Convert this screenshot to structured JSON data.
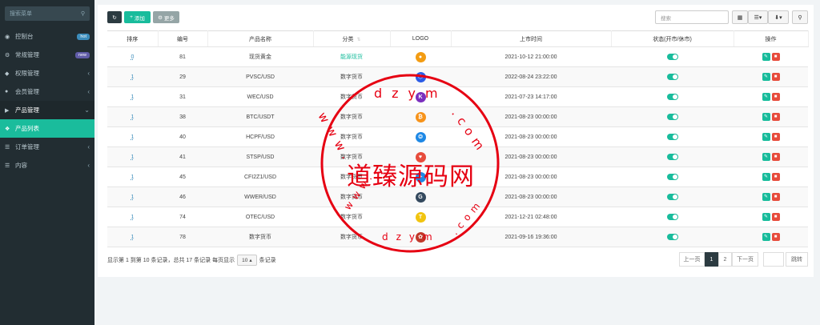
{
  "sidebar": {
    "search_placeholder": "搜索菜单",
    "items": [
      {
        "label": "控制台",
        "badge": "hot",
        "badge_color": "#3c8dbc"
      },
      {
        "label": "常规管理",
        "badge": "new",
        "badge_color": "#605ca8"
      },
      {
        "label": "权限管理"
      },
      {
        "label": "会员管理"
      },
      {
        "label": "产品管理"
      },
      {
        "label": "产品列表"
      },
      {
        "label": "订单管理"
      },
      {
        "label": "内容"
      }
    ]
  },
  "toolbar": {
    "add_label": "添加",
    "more_label": "更多",
    "search_placeholder": "搜索"
  },
  "table": {
    "headers": [
      "排序",
      "编号",
      "产品名称",
      "分类",
      "LOGO",
      "上市时间",
      "状态(开市/休市)",
      "操作"
    ],
    "rows": [
      {
        "weigh": "0",
        "id": "81",
        "name": "现货黄金",
        "category": "能源现货",
        "time": "2021-10-12 21:00:00",
        "logo_color": "#f39c12",
        "logo_char": "●"
      },
      {
        "weigh": "1",
        "id": "29",
        "name": "PVSC/USD",
        "category": "数字货币",
        "time": "2022-08-24 23:22:00",
        "logo_color": "#2b5ce6",
        "logo_char": "⬡"
      },
      {
        "weigh": "1",
        "id": "31",
        "name": "WEC/USD",
        "category": "数字货币",
        "time": "2021-07-23 14:17:00",
        "logo_color": "#7b2fbe",
        "logo_char": "K"
      },
      {
        "weigh": "1",
        "id": "38",
        "name": "BTC/USDT",
        "category": "数字货币",
        "time": "2021-08-23 00:00:00",
        "logo_color": "#f7931a",
        "logo_char": "₿"
      },
      {
        "weigh": "1",
        "id": "40",
        "name": "HCPF/USD",
        "category": "数字货币",
        "time": "2021-08-23 00:00:00",
        "logo_color": "#1e88e5",
        "logo_char": "❂"
      },
      {
        "weigh": "1",
        "id": "41",
        "name": "STSP/USD",
        "category": "数字货币",
        "time": "2021-08-23 00:00:00",
        "logo_color": "#e74c3c",
        "logo_char": "♥"
      },
      {
        "weigh": "1",
        "id": "45",
        "name": "CFI2Z1/USD",
        "category": "数字货币",
        "time": "2021-08-23 00:00:00",
        "logo_color": "#1e88e5",
        "logo_char": "✦"
      },
      {
        "weigh": "1",
        "id": "46",
        "name": "WWER/USD",
        "category": "数字货币",
        "time": "2021-08-23 00:00:00",
        "logo_color": "#34495e",
        "logo_char": "G"
      },
      {
        "weigh": "1",
        "id": "74",
        "name": "OTEC/USD",
        "category": "数字货币",
        "time": "2021-12-21 02:48:00",
        "logo_color": "#f1c40f",
        "logo_char": "T"
      },
      {
        "weigh": "1",
        "id": "78",
        "name": "数字货币",
        "category": "数字货币",
        "time": "2021-09-16 19:36:00",
        "logo_color": "#c0392b",
        "logo_char": "✿"
      }
    ]
  },
  "footer": {
    "info_prefix": "显示第 1 到第 10 条记录，总共 17 条记录 每页显示",
    "page_size": "10",
    "info_suffix": "条记录",
    "prev_label": "上一页",
    "page_1": "1",
    "page_2": "2",
    "next_label": "下一页",
    "jump_label": "跳转"
  },
  "watermark": {
    "top": "dzym",
    "center": "道臻源码网",
    "left": "www.",
    "right": ".com",
    "bottom_left": "www.",
    "bottom": "dzym",
    "bottom_right": ".com"
  }
}
